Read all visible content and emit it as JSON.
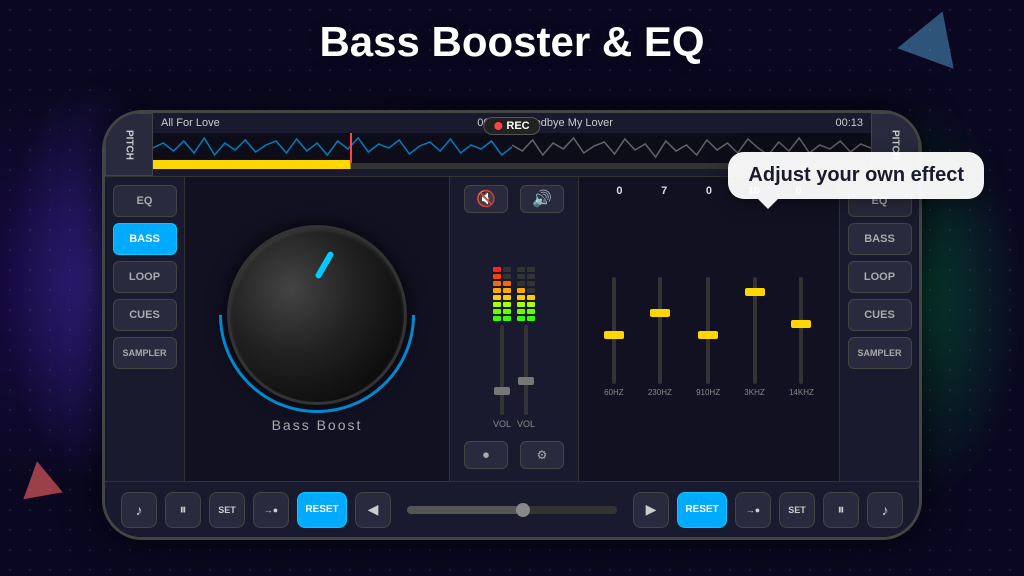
{
  "title": "Bass Booster & EQ",
  "tooltip": "Adjust your own effect",
  "rec_label": "REC",
  "left_track": {
    "name": "All For Love",
    "time": "00:11"
  },
  "right_track": {
    "name": "Goodbye My Lover",
    "time": "00:13"
  },
  "left_panel": {
    "pitch": "PITCH",
    "eq": "EQ",
    "bass": "BASS",
    "loop": "LOOP",
    "cues": "CUES",
    "sampler": "SAMPLER"
  },
  "right_panel": {
    "pitch": "PITCH",
    "eq": "EQ",
    "bass": "BASS",
    "loop": "LOOP",
    "cues": "CUES",
    "sampler": "SAMPLER"
  },
  "knob_label": "Bass  Boost",
  "vol_labels": [
    "VOL",
    "VOL"
  ],
  "eq_values": [
    "0",
    "7",
    "0",
    "10",
    "0"
  ],
  "eq_labels": [
    "60HZ",
    "230HZ",
    "910HZ",
    "3KHZ",
    "14KHZ"
  ],
  "bottom_left": {
    "music": "♪",
    "pause": "⏸",
    "set": "SET",
    "arrow_rec": "→●",
    "reset": "RESET",
    "prev": "◀"
  },
  "bottom_right": {
    "next": "▶",
    "reset": "RESET",
    "arrow_rec": "→●",
    "set": "SET",
    "pause": "⏸",
    "music": "♪"
  }
}
